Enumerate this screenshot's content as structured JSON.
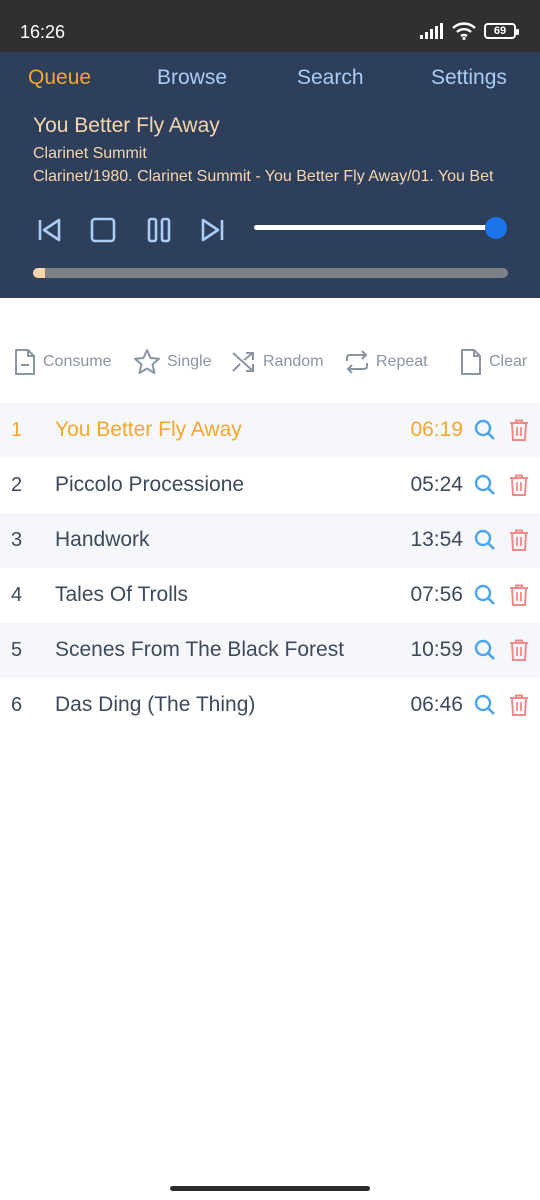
{
  "status": {
    "time": "16:26",
    "battery": "69"
  },
  "nav": {
    "tabs": [
      "Queue",
      "Browse",
      "Search",
      "Settings"
    ],
    "active": "Queue"
  },
  "now_playing": {
    "title": "You Better Fly Away",
    "artist": "Clarinet Summit",
    "path": "Clarinet/1980. Clarinet Summit - You Better Fly Away/01. You Bet",
    "progress": 0.02,
    "volume": 1.0
  },
  "modes": [
    "Consume",
    "Single",
    "Random",
    "Repeat",
    "Clear"
  ],
  "queue": [
    {
      "num": "1",
      "title": "You Better Fly Away",
      "duration": "06:19",
      "current": true
    },
    {
      "num": "2",
      "title": "Piccolo Processione",
      "duration": "05:24",
      "current": false
    },
    {
      "num": "3",
      "title": "Handwork",
      "duration": "13:54",
      "current": false
    },
    {
      "num": "4",
      "title": "Tales Of Trolls",
      "duration": "07:56",
      "current": false
    },
    {
      "num": "5",
      "title": "Scenes From The Black Forest",
      "duration": "10:59",
      "current": false
    },
    {
      "num": "6",
      "title": "Das Ding (The Thing)",
      "duration": "06:46",
      "current": false
    }
  ],
  "colors": {
    "header_bg": "#2e3f5c",
    "accent": "#f4a72b",
    "tab_inactive": "#a9cdf5",
    "now_playing_text": "#f6d5ad",
    "volume_knob": "#1b74ea",
    "search_icon": "#4aa3ec",
    "delete_icon": "#f08a8a",
    "row_text": "#3d4a5c"
  }
}
